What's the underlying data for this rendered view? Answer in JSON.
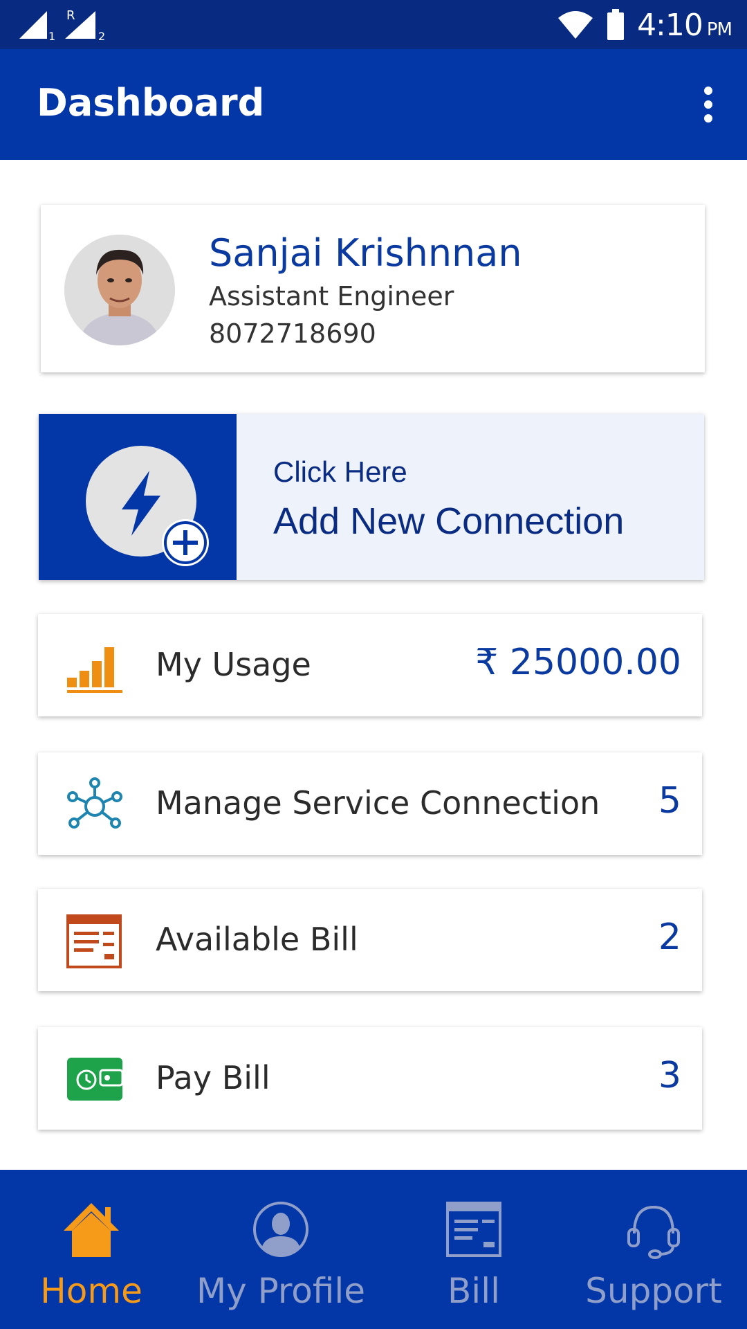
{
  "status_bar": {
    "sim1_label": "1",
    "sim2_label": "2",
    "roaming_label": "R",
    "time": "4:10",
    "ampm": "PM"
  },
  "app_bar": {
    "title": "Dashboard",
    "menu_icon": "more-vert-icon"
  },
  "profile": {
    "name": "Sanjai Krishnnan",
    "role": "Assistant Engineer",
    "phone": "8072718690"
  },
  "add_connection": {
    "subtitle": "Click Here",
    "title": "Add New Connection",
    "icon": "bolt-add-icon"
  },
  "rows": [
    {
      "label": "My Usage",
      "value": "₹ 25000.00",
      "icon": "bar-chart-icon",
      "icon_color": "#ee8e12"
    },
    {
      "label": "Manage Service Connection",
      "value": "5",
      "icon": "network-icon",
      "icon_color": "#1e84b0"
    },
    {
      "label": "Available Bill",
      "value": "2",
      "icon": "bill-icon",
      "icon_color": "#c04a1c"
    },
    {
      "label": "Pay Bill",
      "value": "3",
      "icon": "wallet-icon",
      "icon_color": "#1ea34a"
    }
  ],
  "bottom_nav": {
    "items": [
      {
        "label": "Home",
        "icon": "home-icon",
        "active": true
      },
      {
        "label": "My Profile",
        "icon": "profile-icon",
        "active": false
      },
      {
        "label": "Bill",
        "icon": "bill-icon",
        "active": false
      },
      {
        "label": "Support",
        "icon": "headset-icon",
        "active": false
      }
    ]
  },
  "colors": {
    "primary": "#0336a6",
    "status_bar": "#082a80",
    "accent_active": "#f69a1a",
    "nav_inactive": "#8f9fc9",
    "value_text": "#0a3aa0"
  }
}
